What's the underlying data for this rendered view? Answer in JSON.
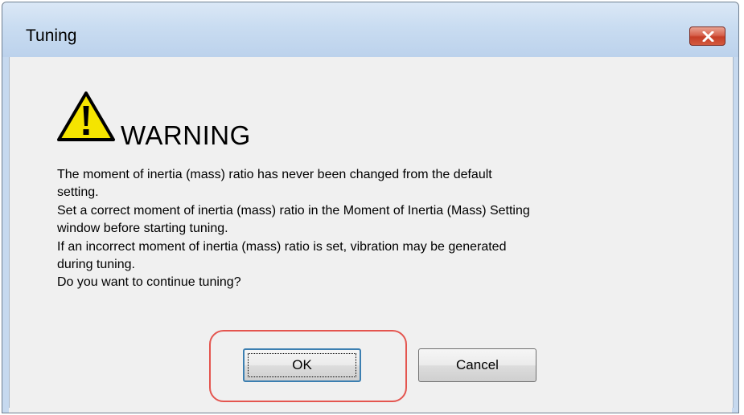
{
  "window": {
    "title": "Tuning",
    "close_icon": "close-icon"
  },
  "dialog": {
    "icon": "warning-icon",
    "heading": "WARNING",
    "message_lines": [
      "The moment of inertia (mass) ratio has never been changed from the default",
      "setting.",
      "Set a correct moment of inertia (mass) ratio in the Moment of Inertia (Mass) Setting",
      "window before starting tuning.",
      "If an incorrect moment of inertia (mass) ratio is set, vibration may be generated",
      "during tuning.",
      "Do you want to continue tuning?"
    ]
  },
  "buttons": {
    "ok_label": "OK",
    "cancel_label": "Cancel"
  },
  "colors": {
    "highlight": "#e4554f",
    "warning_fill": "#f5e400",
    "close_button": "#c63e27"
  }
}
